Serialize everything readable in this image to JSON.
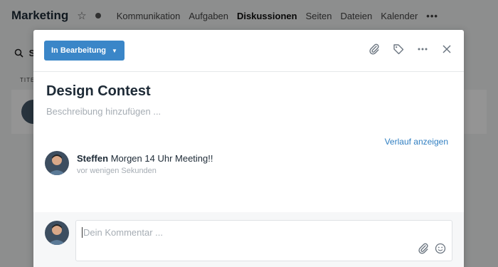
{
  "background": {
    "workspace_title": "Marketing",
    "nav": [
      "Kommunikation",
      "Aufgaben",
      "Diskussionen",
      "Seiten",
      "Dateien",
      "Kalender"
    ],
    "active_nav": "Diskussionen",
    "search_letter": "S",
    "column_header": "TITE"
  },
  "modal": {
    "status_label": "In Bearbeitung",
    "title": "Design Contest",
    "description_placeholder": "Beschreibung hinzufügen ...",
    "history_link": "Verlauf anzeigen",
    "comment": {
      "author": "Steffen",
      "text": "Morgen 14 Uhr Meeting!!",
      "time": "vor wenigen Sekunden"
    },
    "compose_placeholder": "Dein Kommentar ..."
  },
  "icons": [
    "star-icon",
    "attachment-icon",
    "tag-icon",
    "more-icon",
    "close-icon",
    "emoji-icon",
    "search-icon"
  ],
  "colors": {
    "primary": "#3a86c8",
    "link": "#2f7ec1",
    "text_dark": "#1d2a36",
    "text_muted": "#a6adb4"
  }
}
